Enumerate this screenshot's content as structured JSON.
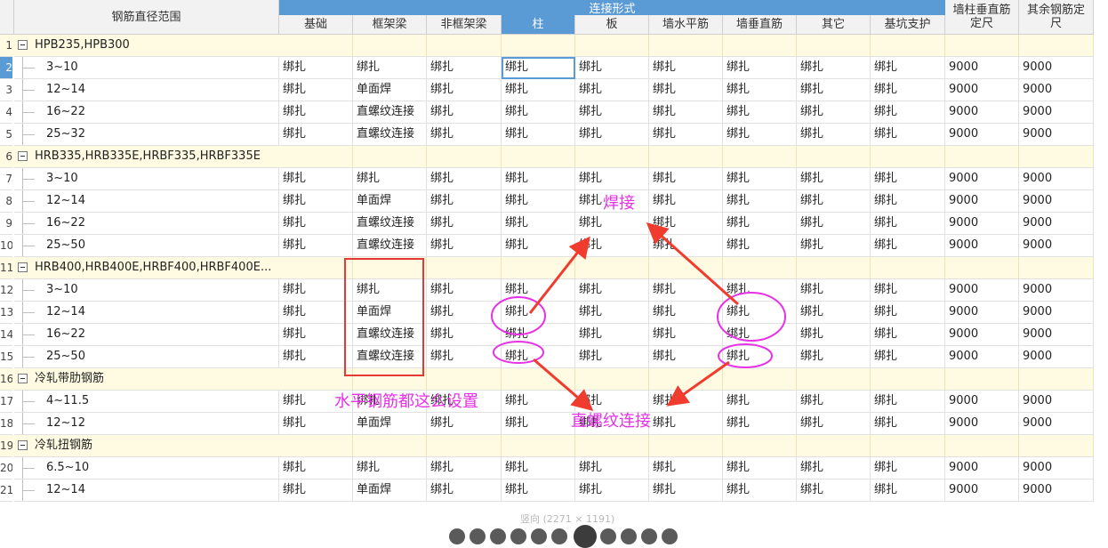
{
  "header": {
    "range_title": "钢筋直径范围",
    "group_title": "连接形式",
    "columns": [
      "基础",
      "框架梁",
      "非框架梁",
      "柱",
      "板",
      "墙水平筋",
      "墙垂直筋",
      "其它",
      "基坑支护"
    ],
    "extra_columns": [
      "墙柱垂直筋定尺",
      "其余钢筋定尺"
    ]
  },
  "rows": [
    {
      "num": "1",
      "type": "group",
      "label": "HPB235,HPB300"
    },
    {
      "num": "2",
      "type": "item",
      "label": "3~10",
      "cells": [
        "绑扎",
        "绑扎",
        "绑扎",
        "绑扎",
        "绑扎",
        "绑扎",
        "绑扎",
        "绑扎",
        "绑扎",
        "9000",
        "9000"
      ]
    },
    {
      "num": "3",
      "type": "item",
      "label": "12~14",
      "cells": [
        "绑扎",
        "单面焊",
        "绑扎",
        "绑扎",
        "绑扎",
        "绑扎",
        "绑扎",
        "绑扎",
        "绑扎",
        "9000",
        "9000"
      ]
    },
    {
      "num": "4",
      "type": "item",
      "label": "16~22",
      "cells": [
        "绑扎",
        "直螺纹连接",
        "绑扎",
        "绑扎",
        "绑扎",
        "绑扎",
        "绑扎",
        "绑扎",
        "绑扎",
        "9000",
        "9000"
      ]
    },
    {
      "num": "5",
      "type": "item",
      "label": "25~32",
      "cells": [
        "绑扎",
        "直螺纹连接",
        "绑扎",
        "绑扎",
        "绑扎",
        "绑扎",
        "绑扎",
        "绑扎",
        "绑扎",
        "9000",
        "9000"
      ]
    },
    {
      "num": "6",
      "type": "group",
      "label": "HRB335,HRB335E,HRBF335,HRBF335E"
    },
    {
      "num": "7",
      "type": "item",
      "label": "3~10",
      "cells": [
        "绑扎",
        "绑扎",
        "绑扎",
        "绑扎",
        "绑扎",
        "绑扎",
        "绑扎",
        "绑扎",
        "绑扎",
        "9000",
        "9000"
      ]
    },
    {
      "num": "8",
      "type": "item",
      "label": "12~14",
      "cells": [
        "绑扎",
        "单面焊",
        "绑扎",
        "绑扎",
        "绑扎",
        "绑扎",
        "绑扎",
        "绑扎",
        "绑扎",
        "9000",
        "9000"
      ]
    },
    {
      "num": "9",
      "type": "item",
      "label": "16~22",
      "cells": [
        "绑扎",
        "直螺纹连接",
        "绑扎",
        "绑扎",
        "绑扎",
        "绑扎",
        "绑扎",
        "绑扎",
        "绑扎",
        "9000",
        "9000"
      ]
    },
    {
      "num": "10",
      "type": "item",
      "label": "25~50",
      "cells": [
        "绑扎",
        "直螺纹连接",
        "绑扎",
        "绑扎",
        "绑扎",
        "绑扎",
        "绑扎",
        "绑扎",
        "绑扎",
        "9000",
        "9000"
      ]
    },
    {
      "num": "11",
      "type": "group",
      "label": "HRB400,HRB400E,HRBF400,HRBF400E..."
    },
    {
      "num": "12",
      "type": "item",
      "label": "3~10",
      "cells": [
        "绑扎",
        "绑扎",
        "绑扎",
        "绑扎",
        "绑扎",
        "绑扎",
        "绑扎",
        "绑扎",
        "绑扎",
        "9000",
        "9000"
      ]
    },
    {
      "num": "13",
      "type": "item",
      "label": "12~14",
      "cells": [
        "绑扎",
        "单面焊",
        "绑扎",
        "绑扎",
        "绑扎",
        "绑扎",
        "绑扎",
        "绑扎",
        "绑扎",
        "9000",
        "9000"
      ]
    },
    {
      "num": "14",
      "type": "item",
      "label": "16~22",
      "cells": [
        "绑扎",
        "直螺纹连接",
        "绑扎",
        "绑扎",
        "绑扎",
        "绑扎",
        "绑扎",
        "绑扎",
        "绑扎",
        "9000",
        "9000"
      ]
    },
    {
      "num": "15",
      "type": "item",
      "label": "25~50",
      "cells": [
        "绑扎",
        "直螺纹连接",
        "绑扎",
        "绑扎",
        "绑扎",
        "绑扎",
        "绑扎",
        "绑扎",
        "绑扎",
        "9000",
        "9000"
      ]
    },
    {
      "num": "16",
      "type": "group",
      "label": "冷轧带肋钢筋"
    },
    {
      "num": "17",
      "type": "item",
      "label": "4~11.5",
      "cells": [
        "绑扎",
        "绑扎",
        "绑扎",
        "绑扎",
        "绑扎",
        "绑扎",
        "绑扎",
        "绑扎",
        "绑扎",
        "9000",
        "9000"
      ]
    },
    {
      "num": "18",
      "type": "item",
      "label": "12~12",
      "cells": [
        "绑扎",
        "单面焊",
        "绑扎",
        "绑扎",
        "绑扎",
        "绑扎",
        "绑扎",
        "绑扎",
        "绑扎",
        "9000",
        "9000"
      ]
    },
    {
      "num": "19",
      "type": "group",
      "label": "冷轧扭钢筋"
    },
    {
      "num": "20",
      "type": "item",
      "label": "6.5~10",
      "cells": [
        "绑扎",
        "绑扎",
        "绑扎",
        "绑扎",
        "绑扎",
        "绑扎",
        "绑扎",
        "绑扎",
        "绑扎",
        "9000",
        "9000"
      ]
    },
    {
      "num": "21",
      "type": "item",
      "label": "12~14",
      "cells": [
        "绑扎",
        "单面焊",
        "绑扎",
        "绑扎",
        "绑扎",
        "绑扎",
        "绑扎",
        "绑扎",
        "绑扎",
        "9000",
        "9000"
      ]
    }
  ],
  "selection": {
    "row": "2",
    "column": "柱"
  },
  "annotations": {
    "weld": "焊接",
    "horizontal": "水平钢筋都这么设置",
    "threaded": "直螺纹连接",
    "color": "#e631e6",
    "arrow_color": "#f03c2e",
    "box_color": "#e53935"
  },
  "footer": {
    "caption": "竖向 (2271 × 1191)"
  },
  "colors": {
    "header_selected": "#5b9bd5",
    "group_row": "#fffbe2"
  }
}
